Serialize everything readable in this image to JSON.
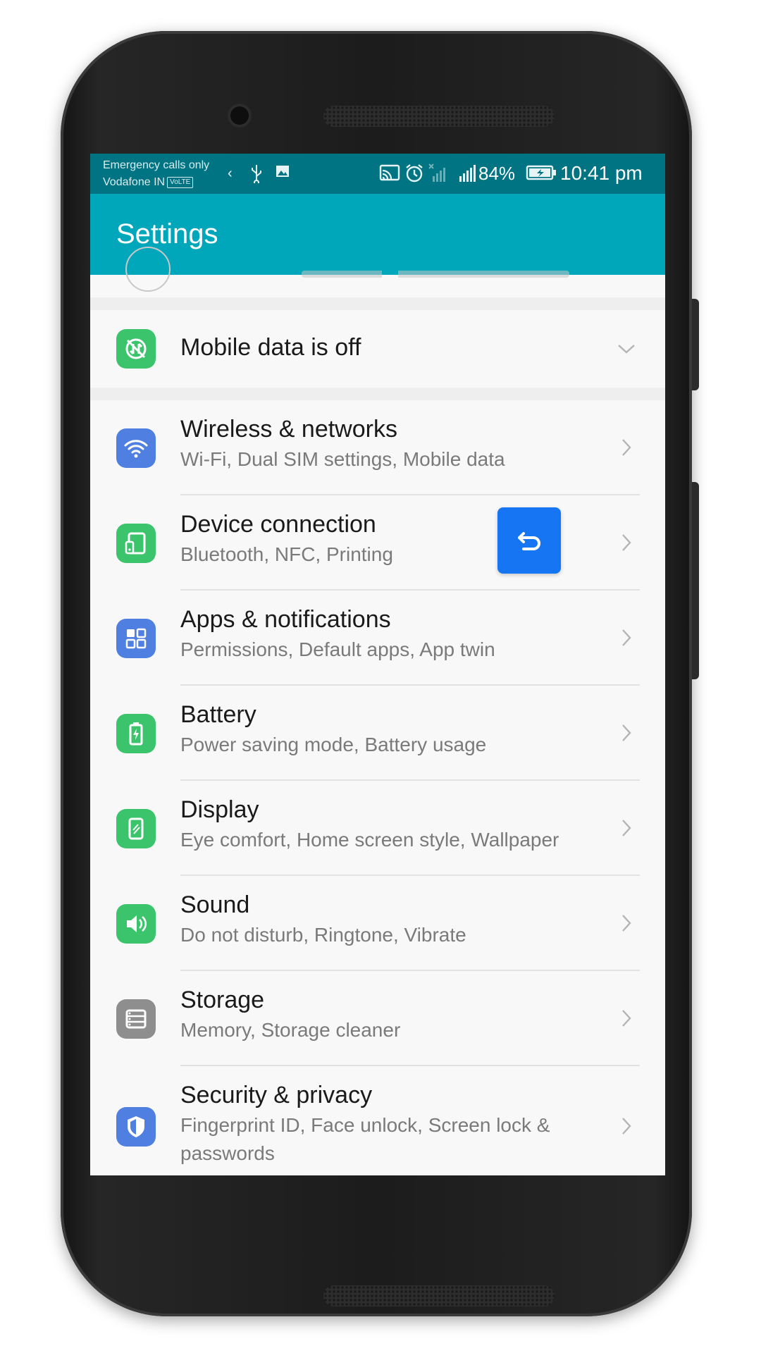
{
  "status_bar": {
    "carrier_line1": "Emergency calls only",
    "carrier_line2": "Vodafone IN",
    "volte_badge": "VoLTE",
    "battery_percent": "84%",
    "time": "10:41 pm",
    "icons": [
      "back-chevron-icon",
      "usb-icon",
      "image-icon",
      "cast-icon",
      "alarm-icon",
      "no-signal-icon",
      "signal-icon",
      "battery-icon"
    ]
  },
  "app_bar": {
    "title": "Settings"
  },
  "mobile_data": {
    "label": "Mobile data is off"
  },
  "settings_items": [
    {
      "title": "Wireless & networks",
      "subtitle": "Wi-Fi, Dual SIM settings, Mobile data",
      "icon": "wifi-icon",
      "color": "#4f7fe0"
    },
    {
      "title": "Device connection",
      "subtitle": "Bluetooth, NFC, Printing",
      "icon": "device-connection-icon",
      "color": "#3cc46c"
    },
    {
      "title": "Apps & notifications",
      "subtitle": "Permissions, Default apps, App twin",
      "icon": "apps-grid-icon",
      "color": "#4f7fe0"
    },
    {
      "title": "Battery",
      "subtitle": "Power saving mode, Battery usage",
      "icon": "battery-settings-icon",
      "color": "#3cc46c"
    },
    {
      "title": "Display",
      "subtitle": "Eye comfort, Home screen style, Wallpaper",
      "icon": "display-icon",
      "color": "#3cc46c"
    },
    {
      "title": "Sound",
      "subtitle": "Do not disturb, Ringtone, Vibrate",
      "icon": "speaker-icon",
      "color": "#3cc46c"
    },
    {
      "title": "Storage",
      "subtitle": "Memory, Storage cleaner",
      "icon": "storage-icon",
      "color": "#8e8e8e"
    },
    {
      "title": "Security & privacy",
      "subtitle_line1": "Fingerprint ID, Face unlock, Screen lock &",
      "subtitle_line2": "passwords",
      "icon": "shield-icon",
      "color": "#4f7fe0"
    }
  ],
  "floating_button": {
    "icon": "undo-arrow-icon",
    "color": "#1675f2"
  },
  "colors": {
    "status_bar": "#007483",
    "app_bar": "#00a7bb",
    "mobile_data_icon": "#3cc46c"
  }
}
